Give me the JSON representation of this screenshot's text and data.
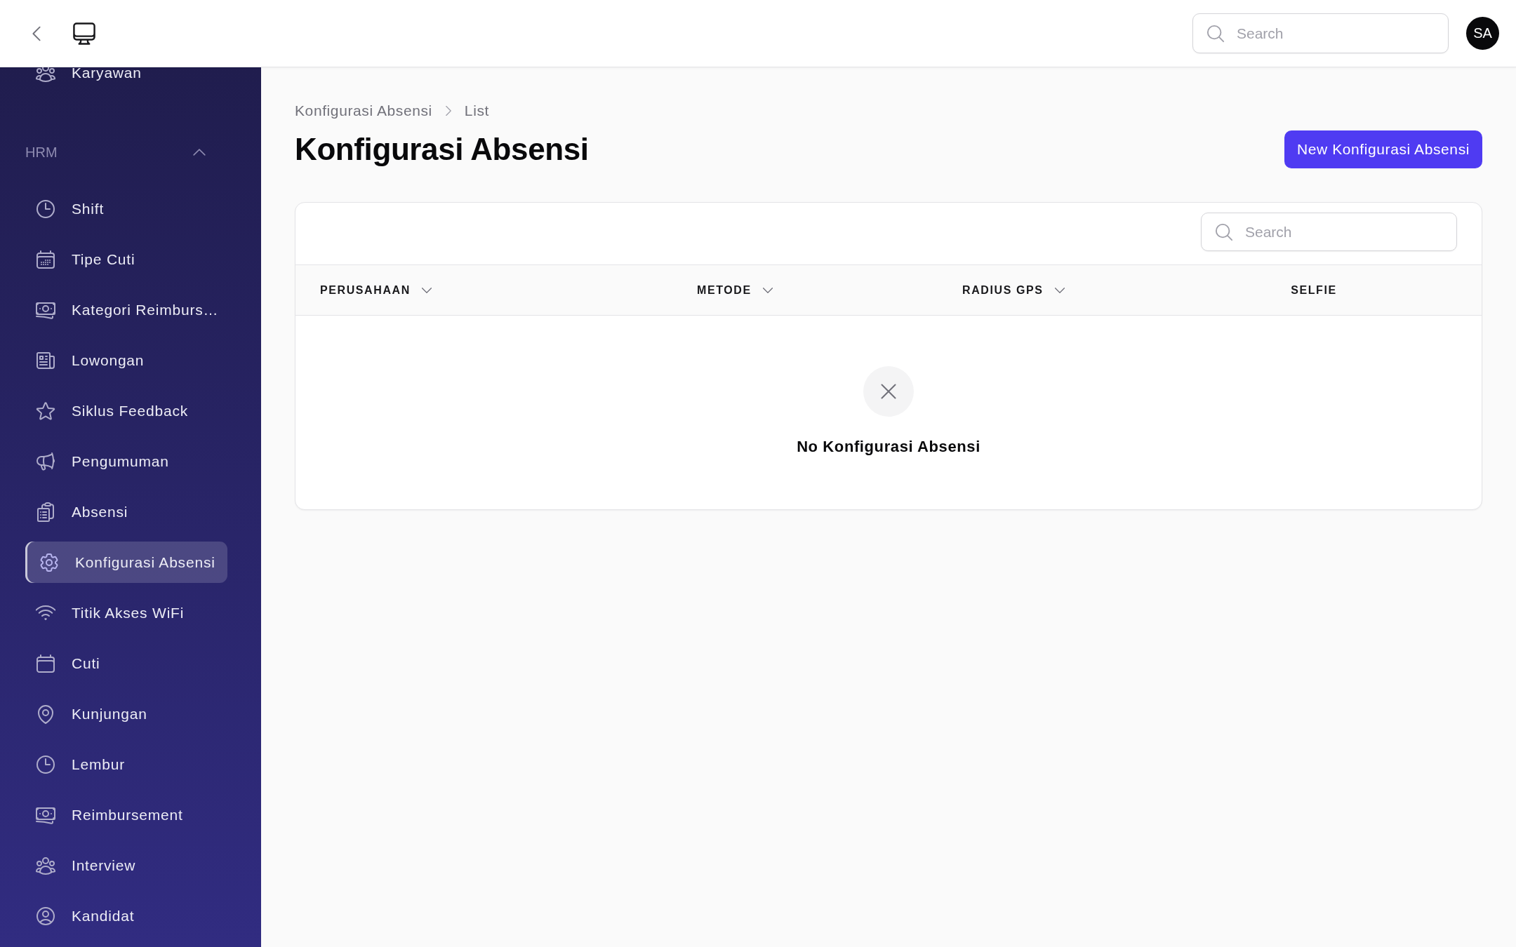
{
  "top_bar": {
    "search": {
      "placeholder": "Search"
    },
    "avatar": {
      "initials": "SA"
    }
  },
  "sidebar": {
    "items": [
      {
        "label": "Karyawan",
        "selected": false
      }
    ],
    "groups": [
      {
        "label": "HRM",
        "expanded": true,
        "items": [
          {
            "label": "Shift",
            "selected": false
          },
          {
            "label": "Tipe Cuti",
            "selected": false
          },
          {
            "label": "Kategori Reimburs…",
            "selected": false
          },
          {
            "label": "Lowongan",
            "selected": false
          },
          {
            "label": "Siklus Feedback",
            "selected": false
          },
          {
            "label": "Pengumuman",
            "selected": false
          },
          {
            "label": "Absensi",
            "selected": false
          },
          {
            "label": "Konfigurasi Absensi",
            "selected": true
          },
          {
            "label": "Titik Akses WiFi",
            "selected": false
          },
          {
            "label": "Cuti",
            "selected": false
          },
          {
            "label": "Kunjungan",
            "selected": false
          },
          {
            "label": "Lembur",
            "selected": false
          },
          {
            "label": "Reimbursement",
            "selected": false
          },
          {
            "label": "Interview",
            "selected": false
          },
          {
            "label": "Kandidat",
            "selected": false
          }
        ]
      }
    ]
  },
  "breadcrumbs": [
    "Konfigurasi Absensi",
    "List"
  ],
  "page": {
    "title": "Konfigurasi Absensi",
    "action": {
      "label": "New Konfigurasi Absensi"
    }
  },
  "table": {
    "search": {
      "placeholder": "Search"
    },
    "columns": [
      {
        "label": "PERUSAHAAN",
        "sortable": true
      },
      {
        "label": "METODE",
        "sortable": true
      },
      {
        "label": "RADIUS GPS",
        "sortable": true
      },
      {
        "label": "SELFIE",
        "sortable": false
      }
    ],
    "empty_state": {
      "message": "No Konfigurasi Absensi"
    }
  }
}
